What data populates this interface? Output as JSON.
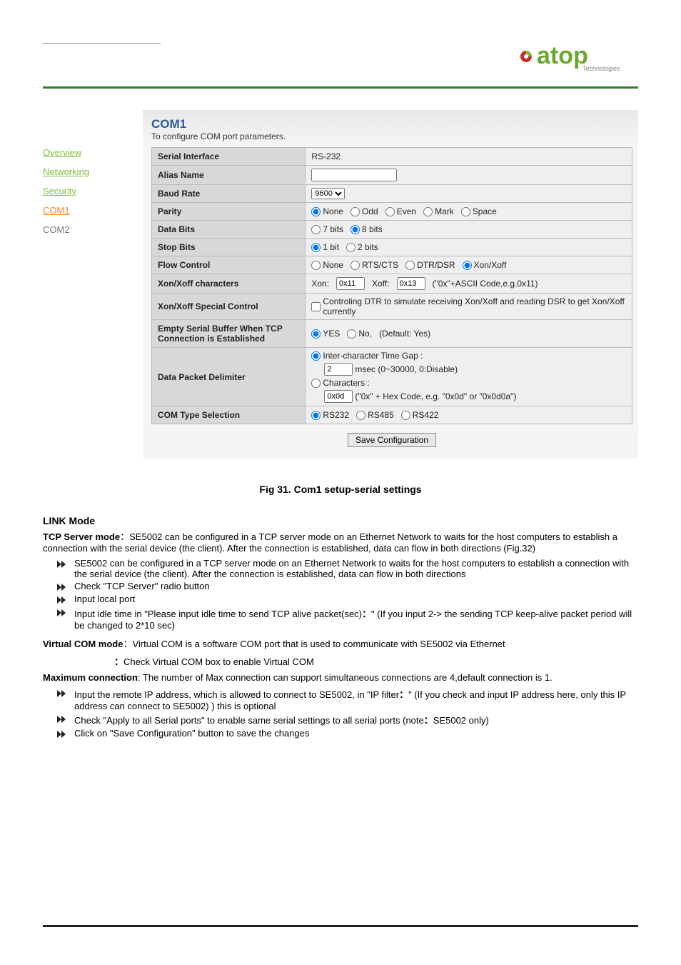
{
  "logo": {
    "brand": "atop",
    "sub": "Technologies"
  },
  "sidebar": {
    "items": [
      {
        "label": "Overview",
        "cls": "sidebar-item"
      },
      {
        "label": "Networking",
        "cls": "sidebar-item"
      },
      {
        "label": "Security",
        "cls": "sidebar-item"
      },
      {
        "label": "COM1",
        "cls": "sidebar-item highlighted"
      },
      {
        "label": "COM2",
        "cls": "sidebar-item inactive"
      }
    ]
  },
  "content": {
    "title": "COM1",
    "subtitle": "To configure COM port parameters.",
    "rows": {
      "serial_interface": {
        "label": "Serial Interface",
        "value": "RS-232"
      },
      "alias": {
        "label": "Alias Name",
        "value": ""
      },
      "baud": {
        "label": "Baud Rate",
        "select_value": "9600"
      },
      "parity": {
        "label": "Parity",
        "options": [
          "None",
          "Odd",
          "Even",
          "Mark",
          "Space"
        ],
        "selected": "None"
      },
      "data_bits": {
        "label": "Data Bits",
        "options": [
          "7 bits",
          "8 bits"
        ],
        "selected": "8 bits"
      },
      "stop_bits": {
        "label": "Stop Bits",
        "options": [
          "1 bit",
          "2 bits"
        ],
        "selected": "1 bit"
      },
      "flow": {
        "label": "Flow Control",
        "options": [
          "None",
          "RTS/CTS",
          "DTR/DSR",
          "Xon/Xoff"
        ],
        "selected": "Xon/Xoff"
      },
      "xonxoff_chars": {
        "label": "Xon/Xoff characters",
        "xon_label": "Xon:",
        "xon_value": "0x11",
        "xoff_label": "Xoff:",
        "xoff_value": "0x13",
        "hint": "(\"0x\"+ASCII Code,e.g.0x11)"
      },
      "xonxoff_special": {
        "label": "Xon/Xoff Special Control",
        "text": "Controling DTR to simulate receiving Xon/Xoff and reading DSR to get Xon/Xoff currently"
      },
      "empty_buf": {
        "label": "Empty Serial Buffer When TCP Connection is Established",
        "options": [
          "YES",
          "No,"
        ],
        "selected": "YES",
        "default_hint": "(Default: Yes)"
      },
      "delimiter": {
        "label": "Data Packet Delimiter",
        "gap_label": "Inter-character Time Gap :",
        "gap_value": "2",
        "gap_hint": "msec (0~30000, 0:Disable)",
        "chars_label": "Characters :",
        "chars_value": "0x0d",
        "chars_hint": "(\"0x\" + Hex Code, e.g. \"0x0d\" or \"0x0d0a\")",
        "selected": "gap"
      },
      "com_type": {
        "label": "COM Type Selection",
        "options": [
          "RS232",
          "RS485",
          "RS422"
        ],
        "selected": "RS232"
      }
    },
    "save_btn": "Save Configuration"
  },
  "figure_caption": "Fig 31. Com1 setup-serial settings",
  "body": {
    "link_mode": {
      "heading": "LINK Mode",
      "intro_label": "TCP Server mode",
      "intro_text": "：SE5002 can be configured in a TCP server mode on an Ethernet Network to waits for the host computers to establish a connection with the serial device (the client). After the connection is established, data can flow in both directions (Fig.32)",
      "bul1": "SE5002 can be configured in a TCP server mode on an Ethernet Network to waits for the host computers to establish a connection with the serial device (the client). After the connection is established, data can flow in both directions",
      "bul2": "Check \"TCP Server\" radio button",
      "bul3": "Input local port",
      "bul4_a": "Input idle time in \"Please input idle time to send TCP alive packet(sec)",
      "bul4_b": "：",
      "bul4_c": "\" (If you input 2-> the sending TCP keep-alive packet period will be changed to 2*10 sec)",
      "virtual_label": "Virtual COM mode",
      "virtual_text": "：Virtual COM is a software COM port that is used to communicate with SE5002 via Ethernet",
      "vc_label": "：",
      "vc_text": "Check Virtual COM box to enable Virtual COM",
      "max_label": "Maximum connection",
      "max_text": ": The number of Max connection can support simultaneous connections are 4,default connection is 1.",
      "bul5_a": "Input the remote IP address, which is allowed to connect to SE5002, in \"IP filter",
      "bul5_b": "：",
      "bul5_c": "\" (If you check and input IP address here, only this IP address can connect to SE5002) ) this is optional",
      "bul6_a": "Check \"Apply to all Serial ports\" to enable same serial settings to all serial ports (note",
      "bul6_b": "：",
      "bul6_c": "SE5002 only)",
      "bul7": "Click on \"Save Configuration\" button to save the changes"
    }
  }
}
